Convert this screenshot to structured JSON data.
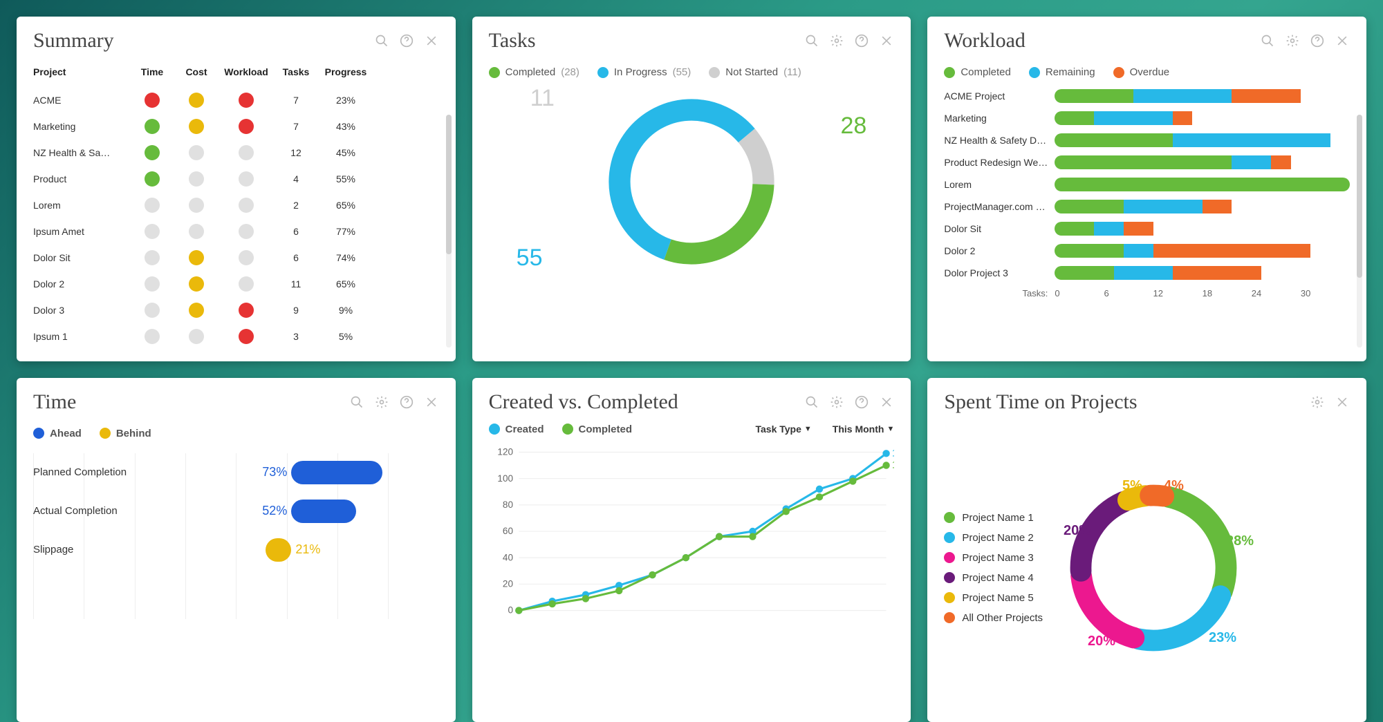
{
  "colors": {
    "green": "#66bb3c",
    "cyan": "#27b8e8",
    "grey": "#cfcfcf",
    "lightgrey": "#e0e0e0",
    "red": "#e63333",
    "yellow": "#eab90b",
    "orange": "#f06a28",
    "blue": "#1f5fd8",
    "pink": "#ec188f",
    "purple": "#6a1b7a"
  },
  "summary": {
    "title": "Summary",
    "columns": [
      "Project",
      "Time",
      "Cost",
      "Workload",
      "Tasks",
      "Progress"
    ],
    "rows": [
      {
        "project": "ACME",
        "time": "red",
        "cost": "yellow",
        "workload": "red",
        "tasks": 7,
        "progress": "23%"
      },
      {
        "project": "Marketing",
        "time": "green",
        "cost": "yellow",
        "workload": "red",
        "tasks": 7,
        "progress": "43%"
      },
      {
        "project": "NZ Health & Sa…",
        "time": "green",
        "cost": "lightgrey",
        "workload": "lightgrey",
        "tasks": 12,
        "progress": "45%"
      },
      {
        "project": "Product",
        "time": "green",
        "cost": "lightgrey",
        "workload": "lightgrey",
        "tasks": 4,
        "progress": "55%"
      },
      {
        "project": "Lorem",
        "time": "lightgrey",
        "cost": "lightgrey",
        "workload": "lightgrey",
        "tasks": 2,
        "progress": "65%"
      },
      {
        "project": "Ipsum Amet",
        "time": "lightgrey",
        "cost": "lightgrey",
        "workload": "lightgrey",
        "tasks": 6,
        "progress": "77%"
      },
      {
        "project": "Dolor Sit",
        "time": "lightgrey",
        "cost": "yellow",
        "workload": "lightgrey",
        "tasks": 6,
        "progress": "74%"
      },
      {
        "project": "Dolor 2",
        "time": "lightgrey",
        "cost": "yellow",
        "workload": "lightgrey",
        "tasks": 11,
        "progress": "65%"
      },
      {
        "project": "Dolor 3",
        "time": "lightgrey",
        "cost": "yellow",
        "workload": "red",
        "tasks": 9,
        "progress": "9%"
      },
      {
        "project": "Ipsum 1",
        "time": "lightgrey",
        "cost": "lightgrey",
        "workload": "red",
        "tasks": 3,
        "progress": "5%"
      }
    ]
  },
  "tasks": {
    "title": "Tasks",
    "legend": [
      {
        "label": "Completed",
        "count": 28,
        "color": "green"
      },
      {
        "label": "In Progress",
        "count": 55,
        "color": "cyan"
      },
      {
        "label": "Not Started",
        "count": 11,
        "color": "grey"
      }
    ],
    "labels": {
      "completed": "28",
      "inprogress": "55",
      "notstarted": "11"
    }
  },
  "workload": {
    "title": "Workload",
    "legend": [
      {
        "label": "Completed",
        "color": "green"
      },
      {
        "label": "Remaining",
        "color": "cyan"
      },
      {
        "label": "Overdue",
        "color": "orange"
      }
    ],
    "axis_label": "Tasks:",
    "ticks": [
      "0",
      "6",
      "12",
      "18",
      "24",
      "30"
    ],
    "rows": [
      {
        "name": "ACME Project",
        "completed": 8,
        "remaining": 10,
        "overdue": 7
      },
      {
        "name": "Marketing",
        "completed": 4,
        "remaining": 8,
        "overdue": 2
      },
      {
        "name": "NZ Health & Safety De…",
        "completed": 12,
        "remaining": 16,
        "overdue": 0
      },
      {
        "name": "Product Redesign We…",
        "completed": 18,
        "remaining": 4,
        "overdue": 2
      },
      {
        "name": "Lorem",
        "completed": 30,
        "remaining": 0,
        "overdue": 0
      },
      {
        "name": "ProjectManager.com …",
        "completed": 7,
        "remaining": 8,
        "overdue": 3
      },
      {
        "name": "Dolor Sit",
        "completed": 4,
        "remaining": 3,
        "overdue": 3
      },
      {
        "name": "Dolor 2",
        "completed": 7,
        "remaining": 3,
        "overdue": 16
      },
      {
        "name": "Dolor Project 3",
        "completed": 6,
        "remaining": 6,
        "overdue": 9
      }
    ],
    "max": 30
  },
  "time": {
    "title": "Time",
    "legend": [
      {
        "label": "Ahead",
        "color": "blue"
      },
      {
        "label": "Behind",
        "color": "yellow"
      }
    ],
    "rows": [
      {
        "label": "Planned Completion",
        "value": 73,
        "dir": "ahead",
        "display": "73%"
      },
      {
        "label": "Actual Completion",
        "value": 52,
        "dir": "ahead",
        "display": "52%"
      },
      {
        "label": "Slippage",
        "value": 21,
        "dir": "behind",
        "display": "21%"
      }
    ]
  },
  "cvc": {
    "title": "Created vs. Completed",
    "legend": [
      {
        "label": "Created",
        "color": "cyan"
      },
      {
        "label": "Completed",
        "color": "green"
      }
    ],
    "filters": {
      "type_label": "Task Type",
      "range_label": "This Month"
    },
    "y_ticks": [
      0,
      20,
      40,
      60,
      80,
      100,
      120
    ],
    "series": {
      "created": [
        0,
        7,
        12,
        19,
        27,
        40,
        56,
        60,
        77,
        92,
        100,
        119
      ],
      "completed": [
        0,
        5,
        9,
        15,
        27,
        40,
        56,
        56,
        75,
        86,
        98,
        110
      ]
    }
  },
  "spent": {
    "title": "Spent Time on Projects",
    "legend": [
      {
        "label": "Project Name 1",
        "color": "green",
        "pct": 28
      },
      {
        "label": "Project Name 2",
        "color": "cyan",
        "pct": 23
      },
      {
        "label": "Project Name 3",
        "color": "pink",
        "pct": 20
      },
      {
        "label": "Project Name 4",
        "color": "purple",
        "pct": 20
      },
      {
        "label": "Project Name 5",
        "color": "yellow",
        "pct": 5
      },
      {
        "label": "All Other Projects",
        "color": "orange",
        "pct": 4
      }
    ]
  },
  "chart_data": [
    {
      "panel": "Tasks",
      "type": "pie",
      "series": [
        {
          "name": "Completed",
          "value": 28
        },
        {
          "name": "In Progress",
          "value": 55
        },
        {
          "name": "Not Started",
          "value": 11
        }
      ]
    },
    {
      "panel": "Workload",
      "type": "bar",
      "orientation": "horizontal",
      "stacked": true,
      "categories": [
        "ACME Project",
        "Marketing",
        "NZ Health & Safety De…",
        "Product Redesign We…",
        "Lorem",
        "ProjectManager.com …",
        "Dolor Sit",
        "Dolor 2",
        "Dolor Project 3"
      ],
      "series": [
        {
          "name": "Completed",
          "values": [
            8,
            4,
            12,
            18,
            30,
            7,
            4,
            7,
            6
          ]
        },
        {
          "name": "Remaining",
          "values": [
            10,
            8,
            16,
            4,
            0,
            8,
            3,
            3,
            6
          ]
        },
        {
          "name": "Overdue",
          "values": [
            7,
            2,
            0,
            2,
            0,
            3,
            3,
            16,
            9
          ]
        }
      ],
      "xlabel": "Tasks",
      "xlim": [
        0,
        30
      ]
    },
    {
      "panel": "Time",
      "type": "bar",
      "orientation": "horizontal",
      "categories": [
        "Planned Completion",
        "Actual Completion",
        "Slippage"
      ],
      "values": [
        73,
        52,
        -21
      ],
      "unit": "%"
    },
    {
      "panel": "Created vs. Completed",
      "type": "line",
      "x": [
        1,
        2,
        3,
        4,
        5,
        6,
        7,
        8,
        9,
        10,
        11,
        12
      ],
      "series": [
        {
          "name": "Created",
          "values": [
            0,
            7,
            12,
            19,
            27,
            40,
            56,
            60,
            77,
            92,
            100,
            119
          ]
        },
        {
          "name": "Completed",
          "values": [
            0,
            5,
            9,
            15,
            27,
            40,
            56,
            56,
            75,
            86,
            98,
            110
          ]
        }
      ],
      "ylim": [
        0,
        120
      ]
    },
    {
      "panel": "Spent Time on Projects",
      "type": "pie",
      "series": [
        {
          "name": "Project Name 1",
          "value": 28
        },
        {
          "name": "Project Name 2",
          "value": 23
        },
        {
          "name": "Project Name 3",
          "value": 20
        },
        {
          "name": "Project Name 4",
          "value": 20
        },
        {
          "name": "Project Name 5",
          "value": 5
        },
        {
          "name": "All Other Projects",
          "value": 4
        }
      ],
      "unit": "%"
    }
  ]
}
